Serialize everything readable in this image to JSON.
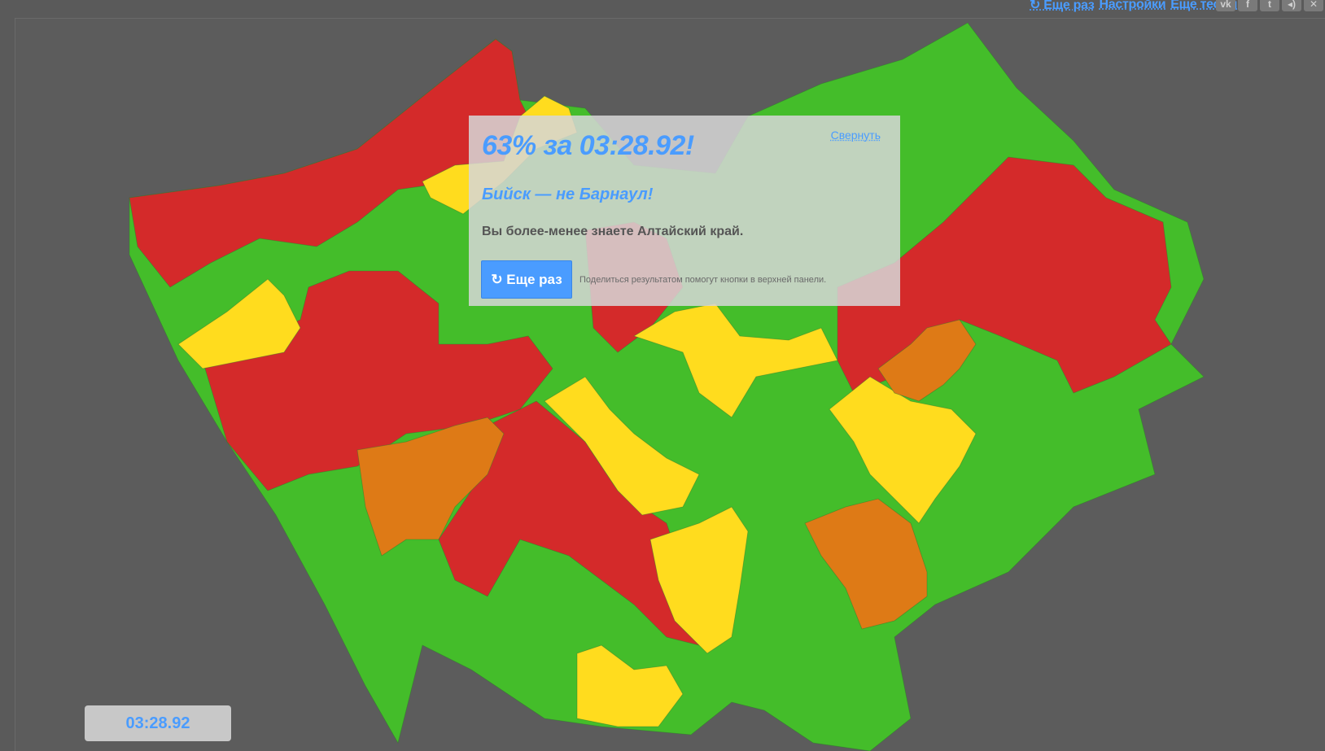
{
  "topbar": {
    "links": [
      "↻ Еще раз",
      "Настройки",
      "Еще тесты"
    ],
    "social": [
      {
        "icon": "vk-icon",
        "glyph": "vk"
      },
      {
        "icon": "facebook-icon",
        "glyph": "f"
      },
      {
        "icon": "twitter-icon",
        "glyph": "t"
      },
      {
        "icon": "sound-icon",
        "glyph": "◂)"
      },
      {
        "icon": "close-icon",
        "glyph": "✕"
      }
    ]
  },
  "result": {
    "score": "63% за 03:28.92!",
    "verdict": "Бийск — не Барнаул!",
    "description": "Вы более-менее знаете Алтайский край.",
    "again_label": "↻ Еще раз",
    "share_hint": "Поделиться результатом помогут кнопки в верхней панели.",
    "collapse_label": "Свернуть"
  },
  "timer": "03:28.92",
  "colors": {
    "green": "#44bd2a",
    "red": "#d42a2a",
    "yellow": "#ffdc1e",
    "orange": "#de7a16",
    "accent": "#4a9cff",
    "background": "#5a5a5a"
  }
}
